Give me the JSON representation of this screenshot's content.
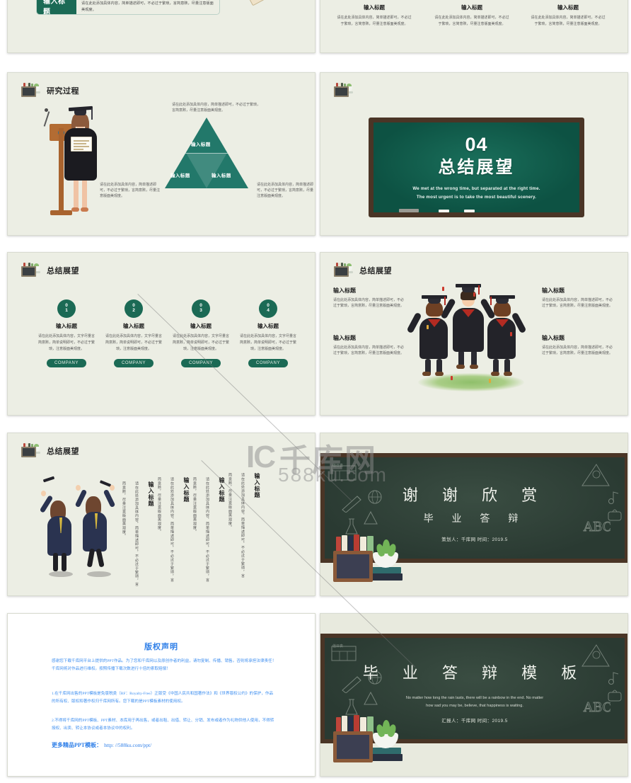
{
  "page": {
    "background": "#ffffff",
    "slide_bg": "#eceee4",
    "accent_green": "#1b6a55",
    "triangle_green": "#22786a",
    "blackboard_green": "#0f5a4a",
    "blackboard_frame": "#4a3526",
    "classboard_green": "#2f4038",
    "copyright_blue": "#2f7fe8"
  },
  "watermark": {
    "logo_mark": "IC",
    "logo_cn": "千库网",
    "domain": "588ku.com"
  },
  "common": {
    "input_title": "输入标题",
    "body_long": "请在此处添加具体内容，简单描述即可，不必过于繁琐，言简意赅，尽量注意版面美观度。",
    "body_short": "请在此处添加具体内容，文字尽量言简意赅，简单说明即可，不必过于繁琐，注意版面美观度。",
    "company": "COMPANY"
  },
  "slides": [
    {
      "id": "slide-01-partial",
      "name": "content-list-slide",
      "rows": [
        {
          "tag": "输入标题",
          "text": "请在此处添加具体内容，简单描述即可，不必过于繁琐，言简意赅，尽量注意版面美观度。"
        }
      ],
      "icon": "pencil-icon"
    },
    {
      "id": "slide-02-partial",
      "name": "three-column-caption-slide",
      "columns": [
        {
          "title": "输入标题",
          "text": "请在此处添加具体内容，简单描述即可，不必过于繁琐，言简意赅，尽量注意版面美观度。"
        },
        {
          "title": "输入标题",
          "text": "请在此处添加具体内容，简单描述即可，不必过于繁琐，言简意赅，尽量注意版面美观度。"
        },
        {
          "title": "输入标题",
          "text": "请在此处添加具体内容，简单描述即可，不必过于繁琐，言简意赅，尽量注意版面美观度。"
        }
      ]
    },
    {
      "id": "slide-03",
      "name": "research-process-slide",
      "header": "研究过程",
      "top_text": "请在此处添加具体内容，简单描述即可，不必过于繁琐，言简意赅，尽量注意版面美观度。",
      "left_text": "请在此处添加具体内容，简单描述即可，不必过于繁琐，言简意赅，尽量注意版面美观度。",
      "right_text": "请在此处添加具体内容，简单描述即可，不必过于繁琐，言简意赅，尽量注意版面美观度。",
      "triangle_labels": [
        "输入标题",
        "输入标题",
        "输入标题"
      ]
    },
    {
      "id": "slide-04",
      "name": "section-divider-slide",
      "number": "04",
      "title": "总结展望",
      "english_line1": "We met at the wrong time, but separated  at the right time.",
      "english_line2": "The most urgent is to take the most beautiful scenery."
    },
    {
      "id": "slide-05",
      "name": "summary-four-steps-slide",
      "header": "总结展望",
      "items": [
        {
          "num_top": "0",
          "num_bottom": "1",
          "title": "输入标题",
          "text": "请在此处添加具体内容，文字尽量言简意赅，简单说明即可，不必过于繁琐，注意版面美观度。",
          "button": "COMPANY"
        },
        {
          "num_top": "0",
          "num_bottom": "2",
          "title": "输入标题",
          "text": "请在此处添加具体内容，文字尽量言简意赅，简单说明即可，不必过于繁琐，注意版面美观度。",
          "button": "COMPANY"
        },
        {
          "num_top": "0",
          "num_bottom": "3",
          "title": "输入标题",
          "text": "请在此处添加具体内容，文字尽量言简意赅，简单说明即可，不必过于繁琐，注意版面美观度。",
          "button": "COMPANY"
        },
        {
          "num_top": "0",
          "num_bottom": "4",
          "title": "输入标题",
          "text": "请在此处添加具体内容，文字尽量言简意赅，简单说明即可，不必过于繁琐，注意版面美观度。",
          "button": "COMPANY"
        }
      ]
    },
    {
      "id": "slide-06",
      "name": "summary-graduates-slide",
      "header": "总结展望",
      "blocks": [
        {
          "title": "输入标题",
          "text": "请在此处添加具体内容，简单描述即可，不必过于繁琐，言简意赅，尽量注意版面美观度。"
        },
        {
          "title": "输入标题",
          "text": "请在此处添加具体内容，简单描述即可，不必过于繁琐，言简意赅，尽量注意版面美观度。"
        },
        {
          "title": "输入标题",
          "text": "请在此处添加具体内容，简单描述即可，不必过于繁琐，言简意赅，尽量注意版面美观度。"
        },
        {
          "title": "输入标题",
          "text": "请在此处添加具体内容，简单描述即可，不必过于繁琐，言简意赅，尽量注意版面美观度。"
        }
      ]
    },
    {
      "id": "slide-07",
      "name": "summary-vertical-text-slide",
      "header": "总结展望",
      "columns": [
        {
          "title": "输入标题",
          "text": "请在此处添加具体内容，简单描述即可，不必过于繁琐，言简意赅，尽量注意版面美观度。"
        },
        {
          "title": "输入标题",
          "text": "请在此处添加具体内容，简单描述即可，不必过于繁琐，言简意赅，尽量注意版面美观度。"
        },
        {
          "title": "输入标题",
          "text": "请在此处添加具体内容，简单描述即可，不必过于繁琐，言简意赅，尽量注意版面美观度。"
        },
        {
          "title": "输入标题",
          "text": "请在此处添加具体内容，简单描述即可，不必过于繁琐，言简意赅，尽量注意版面美观度。"
        }
      ]
    },
    {
      "id": "slide-08",
      "name": "thanks-slide",
      "title": "谢 谢 欣 赏",
      "subtitle": "毕 业 答 辩",
      "meta": "策划人：千库网    时间：2019.5",
      "doodle_label": "值日表"
    },
    {
      "id": "slide-09",
      "name": "copyright-slide",
      "title": "版权声明",
      "paragraph1": "感谢您下载千库网平台上提供的PPT作品。为了您和千库网以及原创作者的利益，请勿复制、传播、销售。否则将承担法律责任！千库网将对作品进行维权。按照传播下载次数进行十倍的索取赔偿！",
      "paragraph2": "1.在千库网出售的PPT模板是免版税类（RF：Royalty-Free）正版受《中国人民共和国著作法》和《世界版权公约》的保护，作品的所有权、版权和著作权归千库网所有。您下载的是PPT模板素材的使用权。",
      "paragraph3": "2.不得将千库网的PPT模板、PPT素材、本库用于再出售，或者出租、出借、转让、分销、发布或者作为礼物供他人使用，不得转授权、出卖、转让本协议或者本协议中的权利。",
      "link_label": "更多精品PPT模板：",
      "link_url": "http: //588ku.com/ppt/"
    },
    {
      "id": "slide-10",
      "name": "cover-title-slide",
      "title": "毕 业 答 辩 模 板",
      "english_line1": "No matter how long the rain lasts, there will be a rainbow in the end. No matter",
      "english_line2": "how sad you may be, believe, that happiness is waiting.",
      "meta": "汇报人：千库网  时间：2019.5",
      "doodle_label": "值日表"
    }
  ]
}
